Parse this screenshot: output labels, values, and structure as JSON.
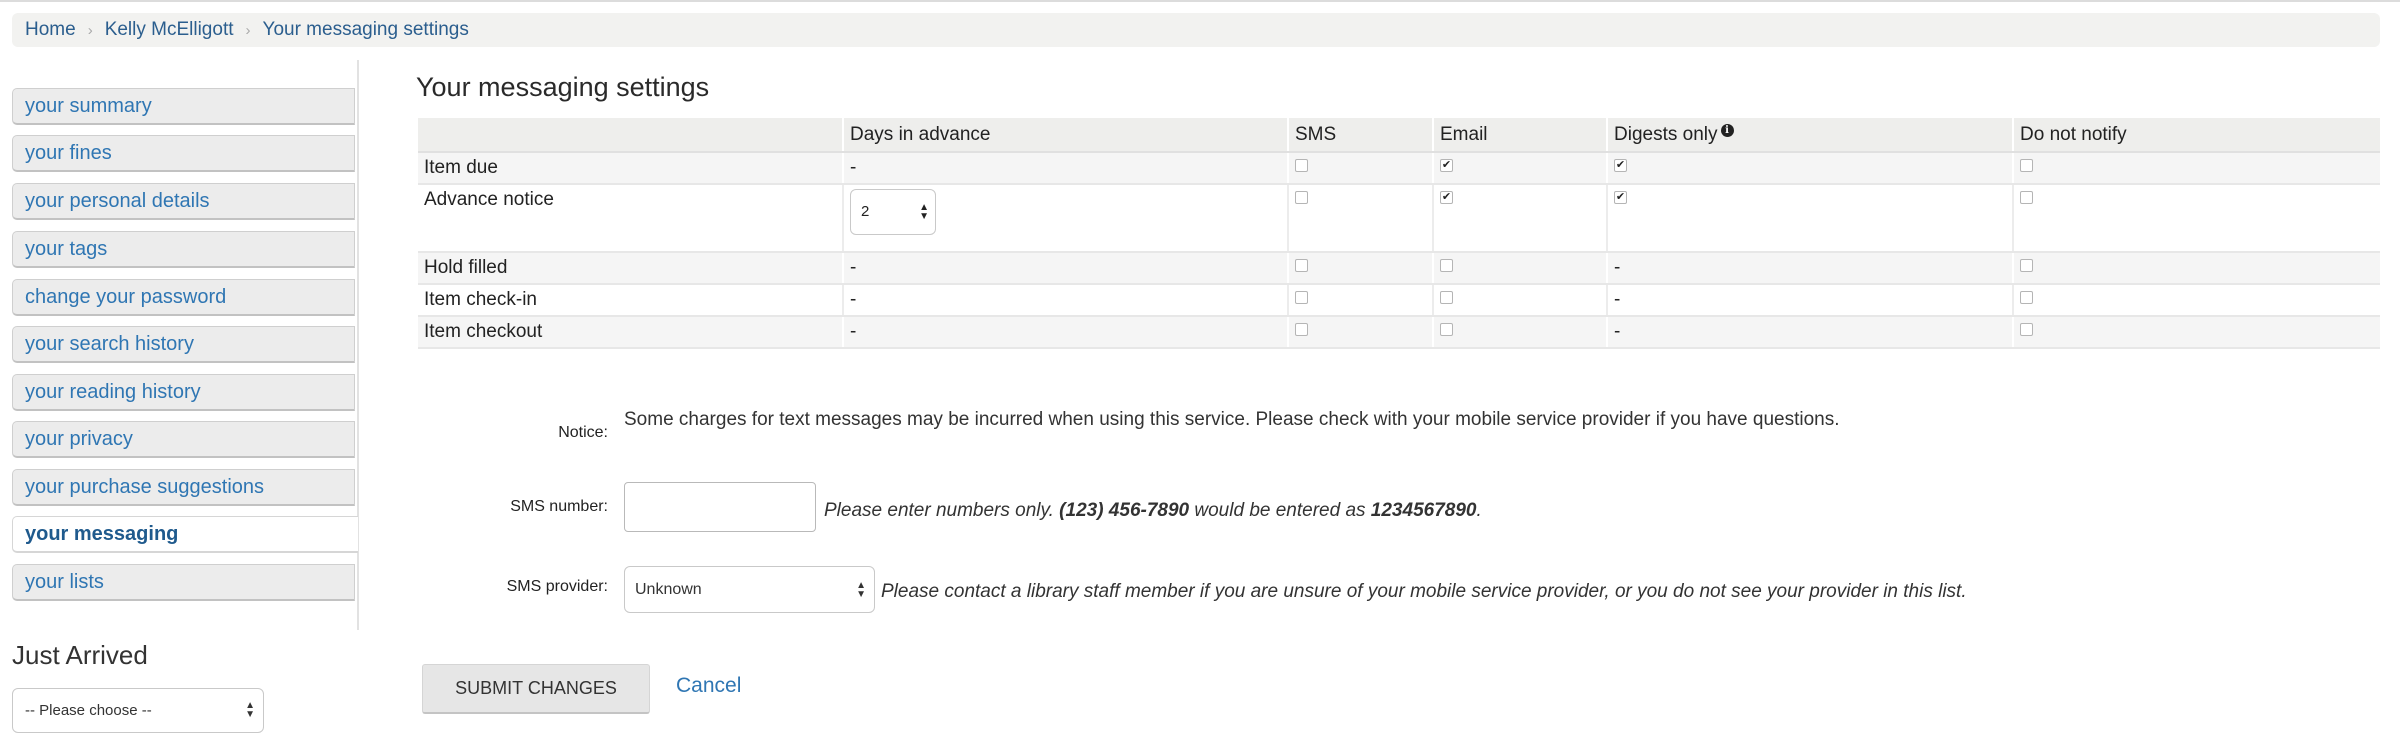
{
  "breadcrumb": [
    "Home",
    "Kelly McElligott",
    "Your messaging settings"
  ],
  "sidebar": {
    "items": [
      {
        "label": "your summary"
      },
      {
        "label": "your fines"
      },
      {
        "label": "your personal details"
      },
      {
        "label": "your tags"
      },
      {
        "label": "change your password"
      },
      {
        "label": "your search history"
      },
      {
        "label": "your reading history"
      },
      {
        "label": "your privacy"
      },
      {
        "label": "your purchase suggestions"
      },
      {
        "label": "your messaging",
        "active": true
      },
      {
        "label": "your lists"
      }
    ]
  },
  "just_arrived": {
    "title": "Just Arrived",
    "select_value": "-- Please choose --"
  },
  "main": {
    "title": "Your messaging settings",
    "table": {
      "headers": [
        "",
        "Days in advance",
        "SMS",
        "Email",
        "Digests only",
        "Do not notify"
      ],
      "rows": [
        {
          "label": "Item due",
          "days": "-",
          "sms": false,
          "email": true,
          "digest": true,
          "do_not_notify": false
        },
        {
          "label": "Advance notice",
          "days_select": "2",
          "sms": false,
          "email": true,
          "digest": true,
          "do_not_notify": false
        },
        {
          "label": "Hold filled",
          "days": "-",
          "sms": false,
          "email": false,
          "digest": "-",
          "do_not_notify": false
        },
        {
          "label": "Item check-in",
          "days": "-",
          "sms": false,
          "email": false,
          "digest": "-",
          "do_not_notify": false
        },
        {
          "label": "Item checkout",
          "days": "-",
          "sms": false,
          "email": false,
          "digest": "-",
          "do_not_notify": false
        }
      ]
    }
  },
  "form": {
    "notice_label": "Notice:",
    "notice_text": "Some charges for text messages may be incurred when using this service. Please check with your mobile service provider if you have questions.",
    "sms_label": "SMS number:",
    "sms_value": "",
    "sms_hint_1": "Please enter numbers only.",
    "sms_hint_2": "(123) 456-7890",
    "sms_hint_3": "would be entered as",
    "sms_hint_4": "1234567890",
    "sms_hint_5": ".",
    "provider_label": "SMS provider:",
    "provider_value": "Unknown",
    "provider_hint": "Please contact a library staff member if you are unsure of your mobile service provider, or you do not see your provider in this list.",
    "submit_label": "SUBMIT CHANGES",
    "cancel_label": "Cancel"
  }
}
